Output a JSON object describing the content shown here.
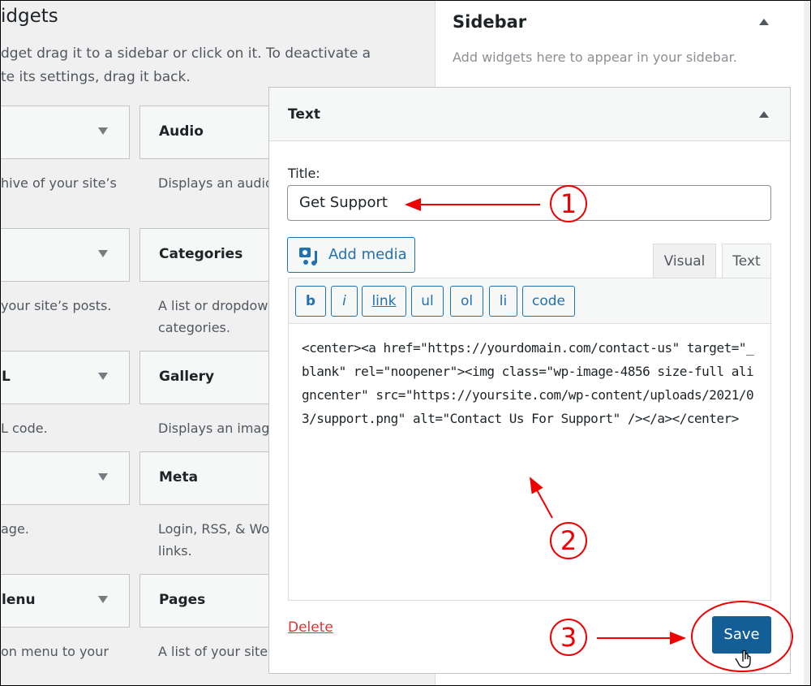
{
  "left": {
    "title_fragment": "idgets",
    "intro_fragment": "dget drag it to a sidebar or click on it. To deactivate a\nte its settings, drag it back.",
    "widgets_left": [
      {
        "title": "",
        "desc": "hive of your site’s"
      },
      {
        "title": "",
        "desc": "your site’s posts."
      },
      {
        "title": "L",
        "desc": "L code."
      },
      {
        "title": "",
        "desc": "age."
      },
      {
        "title": "lenu",
        "desc": "on menu to your"
      }
    ],
    "widgets_right": [
      {
        "title": "Audio",
        "desc": "Displays an audio"
      },
      {
        "title": "Categories",
        "desc": "A list or dropdow\ncategories."
      },
      {
        "title": "Gallery",
        "desc": "Displays an image"
      },
      {
        "title": "Meta",
        "desc": "Login, RSS, & Wo\nlinks."
      },
      {
        "title": "Pages",
        "desc": "A list of your site’"
      }
    ]
  },
  "sidebar": {
    "title": "Sidebar",
    "subtitle": "Add widgets here to appear in your sidebar."
  },
  "panel": {
    "title": "Text",
    "title_label": "Title:",
    "title_value": "Get Support",
    "add_media": "Add media",
    "tabs": [
      "Visual",
      "Text"
    ],
    "active_tab": "Text",
    "quicktags": [
      "b",
      "i",
      "link",
      "ul",
      "ol",
      "li",
      "code"
    ],
    "content": "<center><a href=\"https://yourdomain.com/contact-us\" target=\"_blank\" rel=\"noopener\"><img class=\"wp-image-4856 size-full aligncenter\" src=\"https://yoursite.com/wp-content/uploads/2021/03/support.png\" alt=\"Contact Us For Support\" /></a></center>",
    "delete": "Delete",
    "save": "Save"
  },
  "annotations": [
    "1",
    "2",
    "3"
  ],
  "colors": {
    "accent": "#2271b1",
    "save": "#135e96",
    "annotation": "#ee0000",
    "delete": "#d63638"
  }
}
